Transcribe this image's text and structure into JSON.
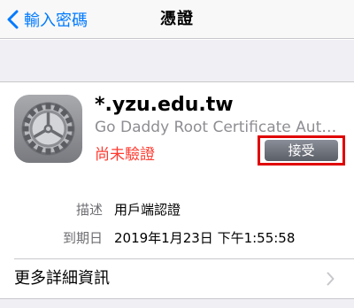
{
  "navbar": {
    "back_label": "輸入密碼",
    "title": "憑證"
  },
  "certificate": {
    "icon": "gear-icon",
    "name": "*.yzu.edu.tw",
    "issuer": "Go Daddy Root Certificate Auth…",
    "status": "尚未驗證",
    "accept_label": "接受"
  },
  "details": [
    {
      "label": "描述",
      "value": "用戶端認證"
    },
    {
      "label": "到期日",
      "value": "2019年1月23日 下午1:55:58"
    }
  ],
  "more": {
    "label": "更多詳細資訊",
    "icon": "chevron-right-icon"
  },
  "colors": {
    "accent": "#007aff",
    "status_red": "#ff3b30",
    "highlight": "#e00000"
  }
}
